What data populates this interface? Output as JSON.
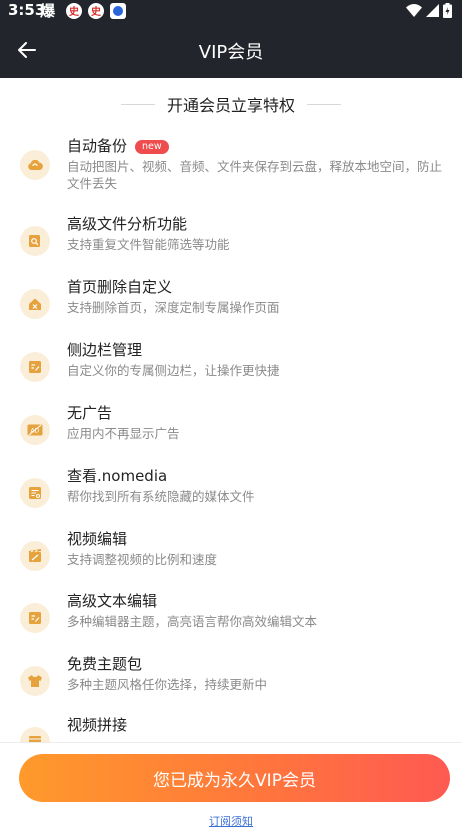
{
  "status_bar": {
    "time": "3:53",
    "notif_char": "爆",
    "badge_char": "史",
    "colors": {
      "bg": "#22252b",
      "red": "#d6302c",
      "blue": "#2a66d8"
    }
  },
  "app_bar": {
    "title": "VIP会员",
    "back_icon": "arrow-left-icon"
  },
  "section_header": "开通会员立享特权",
  "features": [
    {
      "title": "自动备份",
      "badge": "new",
      "desc": "自动把图片、视频、音频、文件夹保存到云盘，释放本地空间，防止文件丢失",
      "icon": "cloud-sync-icon"
    },
    {
      "title": "高级文件分析功能",
      "desc": "支持重复文件智能筛选等功能",
      "icon": "file-search-icon"
    },
    {
      "title": "首页删除自定义",
      "desc": "支持删除首页，深度定制专属操作页面",
      "icon": "home-delete-icon"
    },
    {
      "title": "侧边栏管理",
      "desc": "自定义你的专属侧边栏，让操作更快捷",
      "icon": "sidebar-edit-icon"
    },
    {
      "title": "无广告",
      "desc": "应用内不再显示广告",
      "icon": "no-ads-icon"
    },
    {
      "title": "查看.nomedia",
      "desc": "帮你找到所有系统隐藏的媒体文件",
      "icon": "hidden-media-icon"
    },
    {
      "title": "视频编辑",
      "desc": "支持调整视频的比例和速度",
      "icon": "video-edit-icon"
    },
    {
      "title": "高级文本编辑",
      "desc": "多种编辑器主题，高亮语言帮你高效编辑文本",
      "icon": "text-edit-icon"
    },
    {
      "title": "免费主题包",
      "desc": "多种主题风格任你选择，持续更新中",
      "icon": "theme-shirt-icon"
    },
    {
      "title": "视频拼接",
      "desc": "",
      "icon": "video-merge-icon"
    }
  ],
  "cta": {
    "label": "您已成为永久VIP会员"
  },
  "terms": {
    "label": "订阅须知"
  },
  "colors": {
    "accent_start": "#ff9a2b",
    "accent_end": "#ff5a52",
    "icon_bg": "#fbeed9",
    "icon_fg": "#e6a23c",
    "new_badge": "#ef4d4d",
    "link": "#3a6fd8"
  }
}
